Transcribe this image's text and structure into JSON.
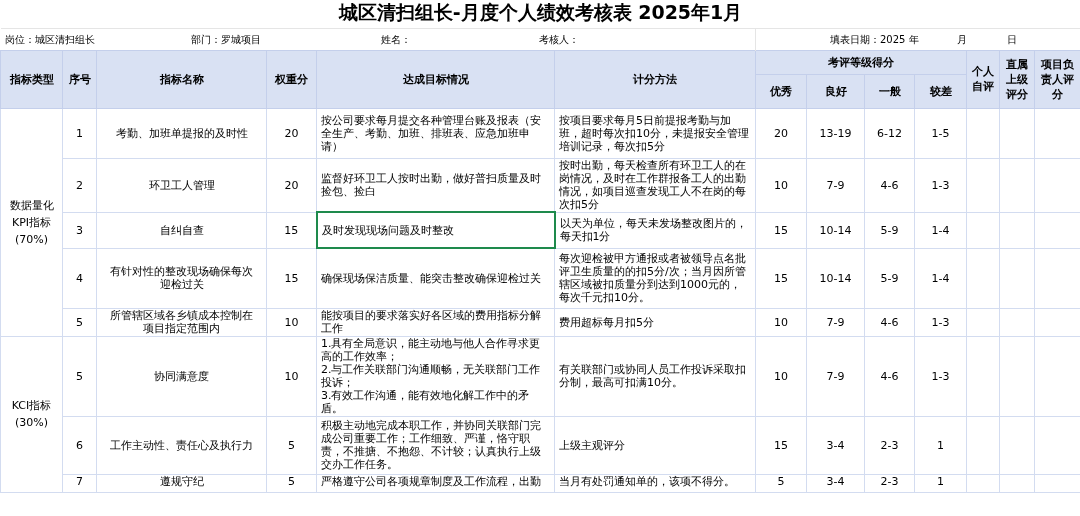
{
  "title": "城区清扫组长-月度个人绩效考核表 2025年1月",
  "info": {
    "position": "岗位：城区清扫组长",
    "department": "部门：罗城项目",
    "name": "姓名：",
    "assessor": "考核人：",
    "date": "填表日期：2025 年",
    "month": "月",
    "day": "日"
  },
  "header": {
    "type": "指标类型",
    "seq": "序号",
    "name": "指标名称",
    "weight": "权重分",
    "goal": "达成目标情况",
    "method": "计分方法",
    "grade_group": "考评等级得分",
    "grades": [
      "优秀",
      "良好",
      "一般",
      "较差"
    ],
    "scores": [
      "个人自评",
      "直属上级评分",
      "项目负责人评分"
    ]
  },
  "groups": [
    {
      "type": "数据量化KPI指标(70%)",
      "rows": [
        {
          "seq": "1",
          "name": "考勤、加班单提报的及时性",
          "weight": "20",
          "goal": "按公司要求每月提交各种管理台账及报表（安全生产、考勤、加班、排班表、应急加班申请）",
          "goal_selected": false,
          "method": "按项目要求每月5日前提报考勤与加班，超时每次扣10分，未提报安全管理培训记录，每次扣5分",
          "grades": [
            "20",
            "13-19",
            "6-12",
            "1-5"
          ]
        },
        {
          "seq": "2",
          "name": "环卫工人管理",
          "weight": "20",
          "goal": "监督好环卫工人按时出勤，做好普扫质量及时捡包、捡白",
          "goal_selected": false,
          "method": "按时出勤，每天检查所有环卫工人的在岗情况，及时在工作群报备工人的出勤情况，如项目巡查发现工人不在岗的每次扣5分",
          "grades": [
            "10",
            "7-9",
            "4-6",
            "1-3"
          ]
        },
        {
          "seq": "3",
          "name": "自纠自查",
          "weight": "15",
          "goal": "及时发现现场问题及时整改",
          "goal_selected": true,
          "method": "以天为单位，每天未发场整改图片的，每天扣1分",
          "grades": [
            "15",
            "10-14",
            "5-9",
            "1-4"
          ]
        },
        {
          "seq": "4",
          "name": "有针对性的整改现场确保每次迎检过关",
          "weight": "15",
          "goal": "确保现场保洁质量、能突击整改确保迎检过关",
          "goal_selected": false,
          "method": "每次迎检被甲方通报或者被领导点名批评卫生质量的的扣5分/次；当月因所管辖区域被扣质量分到达到1000元的，每次千元扣10分。",
          "grades": [
            "15",
            "10-14",
            "5-9",
            "1-4"
          ]
        },
        {
          "seq": "5",
          "name": "所管辖区域各乡镇成本控制在项目指定范围内",
          "weight": "10",
          "goal": "能按项目的要求落实好各区域的费用指标分解工作",
          "goal_selected": false,
          "method": "费用超标每月扣5分",
          "grades": [
            "10",
            "7-9",
            "4-6",
            "1-3"
          ]
        }
      ]
    },
    {
      "type": "KCI指标(30%)",
      "rows": [
        {
          "seq": "5",
          "name": "协同满意度",
          "weight": "10",
          "goal": "1.具有全局意识，能主动地与他人合作寻求更高的工作效率；\n2.与工作关联部门沟通顺畅，无关联部门工作投诉；\n3.有效工作沟通，能有效地化解工作中的矛盾。",
          "goal_selected": false,
          "method": "有关联部门或协同人员工作投诉采取扣分制，最高可扣满10分。",
          "grades": [
            "10",
            "7-9",
            "4-6",
            "1-3"
          ]
        },
        {
          "seq": "6",
          "name": "工作主动性、责任心及执行力",
          "weight": "5",
          "goal": "积极主动地完成本职工作，并协同关联部门完成公司重要工作；工作细致、严谨，恪守职责，不推搪、不抱怨、不计较；认真执行上级交办工作任务。",
          "goal_selected": false,
          "method": "上级主观评分",
          "grades": [
            "15",
            "3-4",
            "2-3",
            "1"
          ]
        },
        {
          "seq": "7",
          "name": "遵规守纪",
          "weight": "5",
          "goal": "严格遵守公司各项规章制度及工作流程，出勤",
          "goal_selected": false,
          "method": "当月有处罚通知单的，该项不得分。",
          "grades": [
            "5",
            "3-4",
            "2-3",
            "1"
          ]
        }
      ]
    }
  ]
}
